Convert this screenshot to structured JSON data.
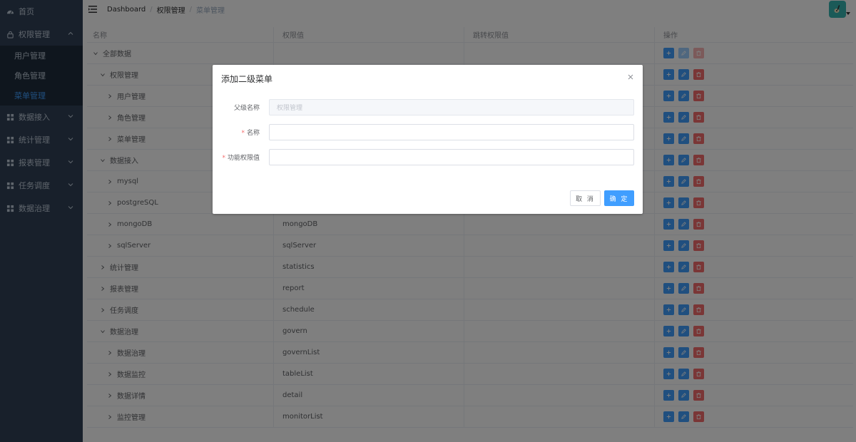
{
  "sidebar": {
    "items": [
      {
        "label": "首页",
        "icon": "dashboard-icon"
      },
      {
        "label": "权限管理",
        "icon": "lock-icon",
        "expanded": true,
        "children": [
          {
            "label": "用户管理",
            "active": false
          },
          {
            "label": "角色管理",
            "active": false
          },
          {
            "label": "菜单管理",
            "active": true
          }
        ]
      },
      {
        "label": "数据接入",
        "icon": "grid-icon"
      },
      {
        "label": "统计管理",
        "icon": "grid-icon"
      },
      {
        "label": "报表管理",
        "icon": "grid-icon"
      },
      {
        "label": "任务调度",
        "icon": "grid-icon"
      },
      {
        "label": "数据治理",
        "icon": "grid-icon"
      }
    ]
  },
  "breadcrumb": {
    "items": [
      "Dashboard",
      "权限管理",
      "菜单管理"
    ]
  },
  "table": {
    "headers": [
      "名称",
      "权限值",
      "跳转权限值",
      "操作"
    ],
    "rows": [
      {
        "name": "全部数据",
        "value": "",
        "redirect": "",
        "level": 0,
        "expanded": true,
        "edit_disabled": true
      },
      {
        "name": "权限管理",
        "value": "",
        "redirect": "",
        "level": 1,
        "expanded": true
      },
      {
        "name": "用户管理",
        "value": "",
        "redirect": "",
        "level": 2,
        "expanded": false
      },
      {
        "name": "角色管理",
        "value": "",
        "redirect": "",
        "level": 2,
        "expanded": false
      },
      {
        "name": "菜单管理",
        "value": "",
        "redirect": "",
        "level": 2,
        "expanded": false
      },
      {
        "name": "数据接入",
        "value": "",
        "redirect": "",
        "level": 1,
        "expanded": true
      },
      {
        "name": "mysql",
        "value": "",
        "redirect": "",
        "level": 2,
        "expanded": false
      },
      {
        "name": "postgreSQL",
        "value": "",
        "redirect": "",
        "level": 2,
        "expanded": false
      },
      {
        "name": "mongoDB",
        "value": "mongoDB",
        "redirect": "",
        "level": 2,
        "expanded": false
      },
      {
        "name": "sqlServer",
        "value": "sqlServer",
        "redirect": "",
        "level": 2,
        "expanded": false
      },
      {
        "name": "统计管理",
        "value": "statistics",
        "redirect": "",
        "level": 1,
        "expanded": false
      },
      {
        "name": "报表管理",
        "value": "report",
        "redirect": "",
        "level": 1,
        "expanded": false
      },
      {
        "name": "任务调度",
        "value": "schedule",
        "redirect": "",
        "level": 1,
        "expanded": false
      },
      {
        "name": "数据治理",
        "value": "govern",
        "redirect": "",
        "level": 1,
        "expanded": true
      },
      {
        "name": "数据治理",
        "value": "governList",
        "redirect": "",
        "level": 2,
        "expanded": false
      },
      {
        "name": "数据监控",
        "value": "tableList",
        "redirect": "",
        "level": 2,
        "expanded": false
      },
      {
        "name": "数据详情",
        "value": "detail",
        "redirect": "",
        "level": 2,
        "expanded": false
      },
      {
        "name": "监控管理",
        "value": "monitorList",
        "redirect": "",
        "level": 2,
        "expanded": false
      }
    ]
  },
  "dialog": {
    "title": "添加二级菜单",
    "fields": [
      {
        "label": "父级名称",
        "required": false,
        "value": "权限管理",
        "disabled": true
      },
      {
        "label": "名称",
        "required": true,
        "value": "",
        "disabled": false
      },
      {
        "label": "功能权限值",
        "required": true,
        "value": "",
        "disabled": false
      }
    ],
    "cancel_label": "取 消",
    "ok_label": "确 定"
  },
  "colors": {
    "sidebar_bg": "#304156",
    "submenu_bg": "#1f2d3d",
    "primary": "#409eff",
    "danger": "#f56c6c",
    "avatar_bg": "#36b5b0"
  }
}
